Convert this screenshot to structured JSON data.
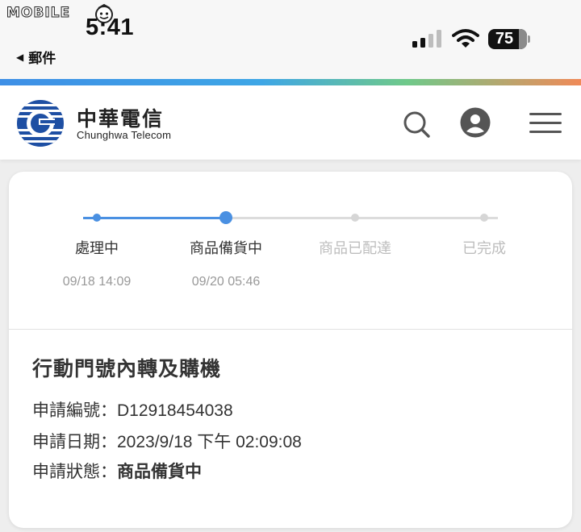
{
  "status_bar": {
    "watermark": "MOBILE",
    "time": "5:41",
    "back_label": "郵件",
    "battery": "75"
  },
  "header": {
    "logo_cn": "中華電信",
    "logo_en": "Chunghwa Telecom",
    "icons": [
      "search-icon",
      "user-avatar-icon",
      "hamburger-menu-icon"
    ]
  },
  "progress": {
    "steps": [
      {
        "label": "處理中",
        "time": "09/18 14:09",
        "state": "done"
      },
      {
        "label": "商品備貨中",
        "time": "09/20 05:46",
        "state": "current"
      },
      {
        "label": "商品已配達",
        "time": "",
        "state": "pending"
      },
      {
        "label": "已完成",
        "time": "",
        "state": "pending"
      }
    ],
    "accent_color": "#4a90e2",
    "pending_color": "#d6d6d6"
  },
  "order": {
    "title": "行動門號內轉及購機",
    "rows": [
      {
        "label": "申請編號：",
        "value": "D12918454038"
      },
      {
        "label": "申請日期：",
        "value": "2023/9/18 下午 02:09:08"
      },
      {
        "label": "申請狀態：",
        "value": "商品備貨中"
      }
    ]
  }
}
